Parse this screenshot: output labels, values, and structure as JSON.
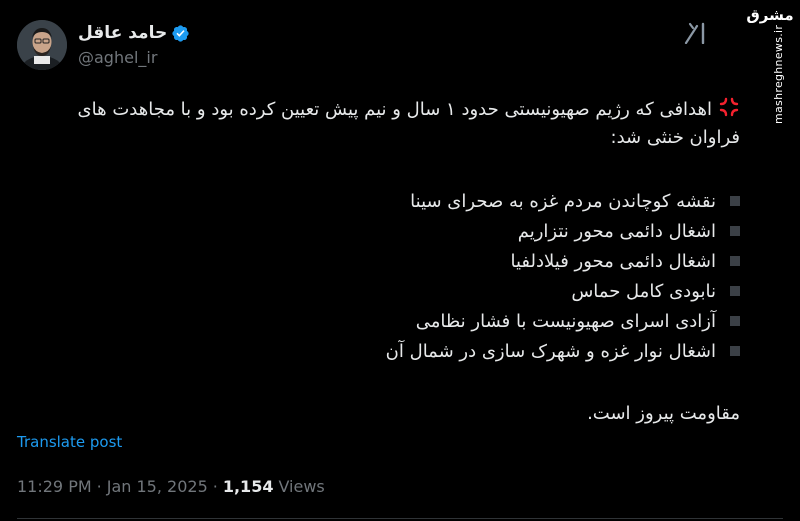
{
  "author": {
    "display_name": "حامد عاقل",
    "handle": "@aghel_ir",
    "verified_color": "#1d9bf0"
  },
  "watermark": {
    "brand": "مشرق",
    "url": "mashreghnews.ir"
  },
  "tweet": {
    "intro": "اهدافی که رژیم صهیونیستی حدود ۱ سال و نیم پیش تعیین کرده بود و با مجاهدت های فراوان خنثی شد:",
    "goals": [
      "نقشه کوچاندن مردم غزه به صحرای سینا",
      "اشغال دائمی محور نتزاریم",
      "اشغال دائمی محور فیلادلفیا",
      "نابودی کامل حماس",
      "آزادی اسرای صهیونیست با فشار نظامی",
      "اشغال نوار غزه و شهرک سازی در شمال آن"
    ],
    "closing": "مقاومت پیروز است."
  },
  "translate_label": "Translate post",
  "meta": {
    "time": "11:29 PM",
    "sep1": "·",
    "date": "Jan 15, 2025",
    "sep2": "·",
    "views_count": "1,154",
    "views_label": "Views"
  },
  "icons": {
    "verified": "verified-badge-icon",
    "x_logo": "x-grok-icon",
    "angry": "anger-symbol-icon"
  },
  "colors": {
    "background": "#000000",
    "text": "#e7e9ea",
    "muted": "#71767b",
    "link": "#1d9bf0",
    "angry": "#f4212e"
  }
}
